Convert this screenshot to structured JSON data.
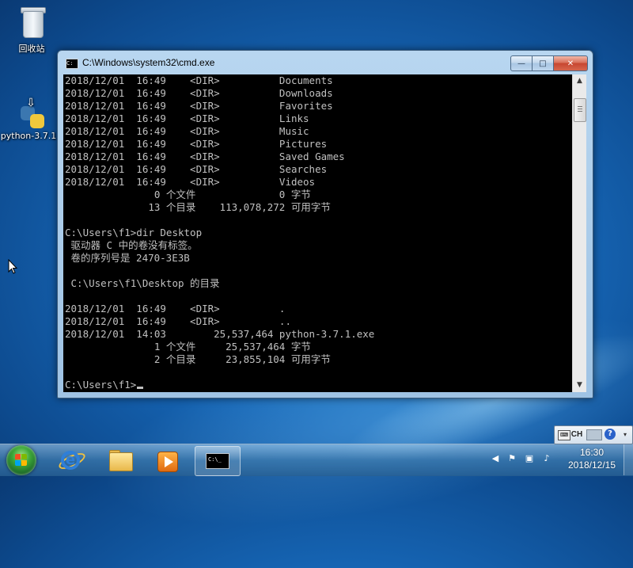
{
  "desktop": {
    "icons": [
      {
        "label": "回收站"
      },
      {
        "label": "python-3.7.1"
      }
    ]
  },
  "window": {
    "title": "C:\\Windows\\system32\\cmd.exe",
    "buttons": {
      "minimize": "—",
      "maximize": "□",
      "close": "✕"
    }
  },
  "console": {
    "lines": [
      "2018/12/01  16:49    <DIR>          Documents",
      "2018/12/01  16:49    <DIR>          Downloads",
      "2018/12/01  16:49    <DIR>          Favorites",
      "2018/12/01  16:49    <DIR>          Links",
      "2018/12/01  16:49    <DIR>          Music",
      "2018/12/01  16:49    <DIR>          Pictures",
      "2018/12/01  16:49    <DIR>          Saved Games",
      "2018/12/01  16:49    <DIR>          Searches",
      "2018/12/01  16:49    <DIR>          Videos",
      "               0 个文件              0 字节",
      "              13 个目录    113,078,272 可用字节",
      "",
      "C:\\Users\\f1>dir Desktop",
      " 驱动器 C 中的卷没有标签。",
      " 卷的序列号是 2470-3E3B",
      "",
      " C:\\Users\\f1\\Desktop 的目录",
      "",
      "2018/12/01  16:49    <DIR>          .",
      "2018/12/01  16:49    <DIR>          ..",
      "2018/12/01  14:03        25,537,464 python-3.7.1.exe",
      "               1 个文件     25,537,464 字节",
      "               2 个目录     23,855,104 可用字节",
      "",
      "C:\\Users\\f1>"
    ]
  },
  "taskbar": {
    "apps": [
      {
        "name": "Internet Explorer"
      },
      {
        "name": "Windows Explorer"
      },
      {
        "name": "Windows Media Player"
      },
      {
        "name": "cmd.exe",
        "active": true
      }
    ],
    "cmd_icon_text": "C:\\_",
    "tray": {
      "language": "CH",
      "help": "?",
      "time": "16:30",
      "date": "2018/12/15"
    }
  }
}
